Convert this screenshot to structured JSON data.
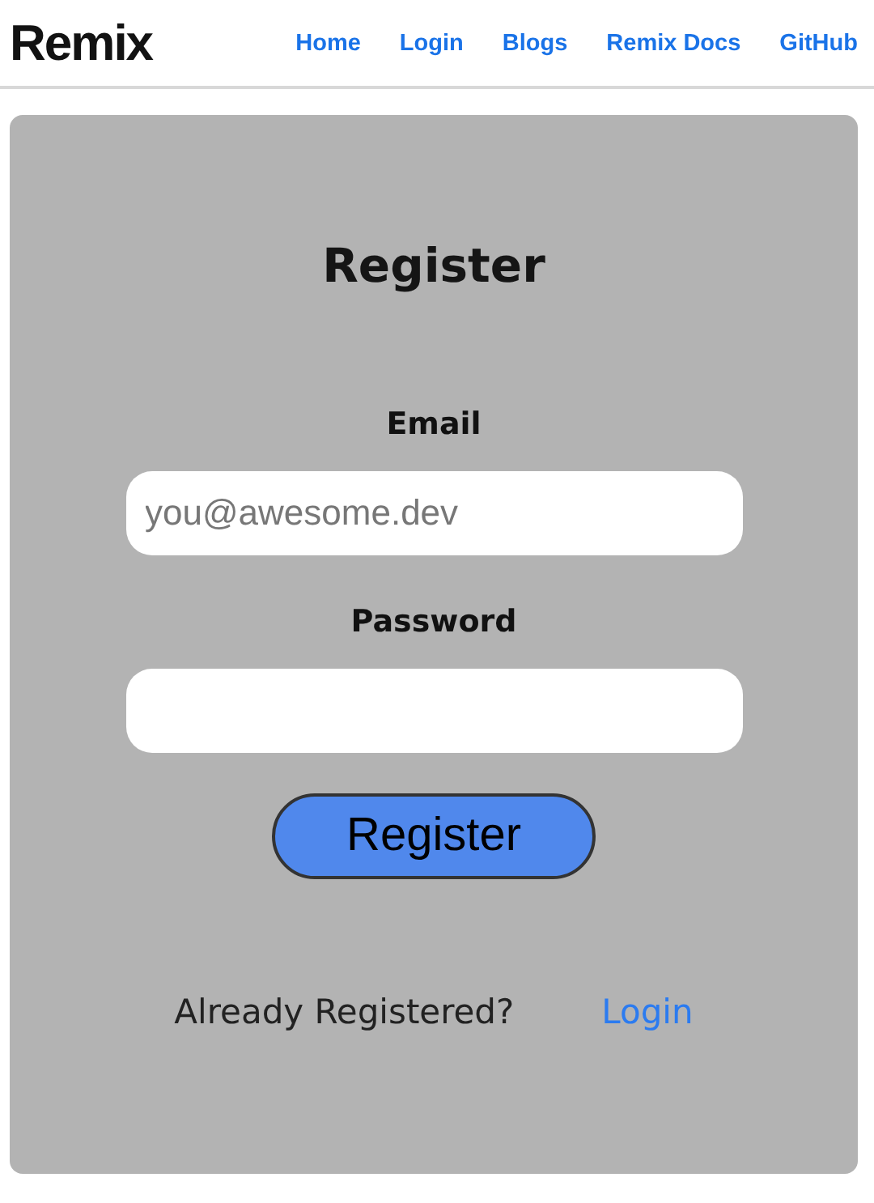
{
  "header": {
    "logo": "Remix",
    "nav": [
      "Home",
      "Login",
      "Blogs",
      "Remix Docs",
      "GitHub"
    ]
  },
  "form": {
    "title": "Register",
    "fields": [
      {
        "label": "Email",
        "placeholder": "you@awesome.dev"
      },
      {
        "label": "Password"
      }
    ],
    "submit": "Register",
    "footer_text": "Already Registered?",
    "footer_link": "Login"
  }
}
